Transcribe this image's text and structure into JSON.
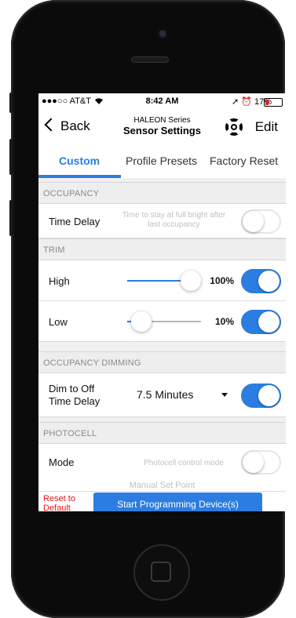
{
  "status_bar": {
    "carrier": "●●●○○ AT&T",
    "wifi_icon": "wifi-icon",
    "time": "8:42 AM",
    "right_indicators": "➚ ⏰ 17%",
    "battery_percent": 17,
    "battery_color": "#e02020"
  },
  "nav": {
    "back_label": "Back",
    "series": "HALEON Series",
    "title": "Sensor Settings",
    "help_icon": "lifebuoy-icon",
    "edit_label": "Edit"
  },
  "tabs": [
    {
      "label": "Custom",
      "active": true
    },
    {
      "label": "Profile Presets",
      "active": false
    },
    {
      "label": "Factory Reset",
      "active": false
    }
  ],
  "accent_color": "#2b7de1",
  "sections": {
    "occupancy": {
      "header": "OCCUPANCY",
      "time_delay": {
        "label": "Time Delay",
        "hint": "Time to stay at full bright after last occupancy",
        "enabled": false
      }
    },
    "trim": {
      "header": "TRIM",
      "high": {
        "label": "High",
        "value": "100%",
        "level": 1.0,
        "enabled": true
      },
      "low": {
        "label": "Low",
        "value": "10%",
        "level": 0.1,
        "enabled": true
      }
    },
    "occupancy_dimming": {
      "header": "OCCUPANCY DIMMING",
      "dim_to_off": {
        "label_line1": "Dim to Off",
        "label_line2": "Time Delay",
        "value": "7.5 Minutes",
        "enabled": true
      }
    },
    "photocell": {
      "header": "PHOTOCELL",
      "mode": {
        "label": "Mode",
        "hint": "Photocell control mode",
        "enabled": false
      },
      "manual_set_point": "Manual Set Point"
    }
  },
  "footer": {
    "reset_line1": "Reset to",
    "reset_line2": "Default",
    "start_button": "Start Programming Device(s)"
  }
}
